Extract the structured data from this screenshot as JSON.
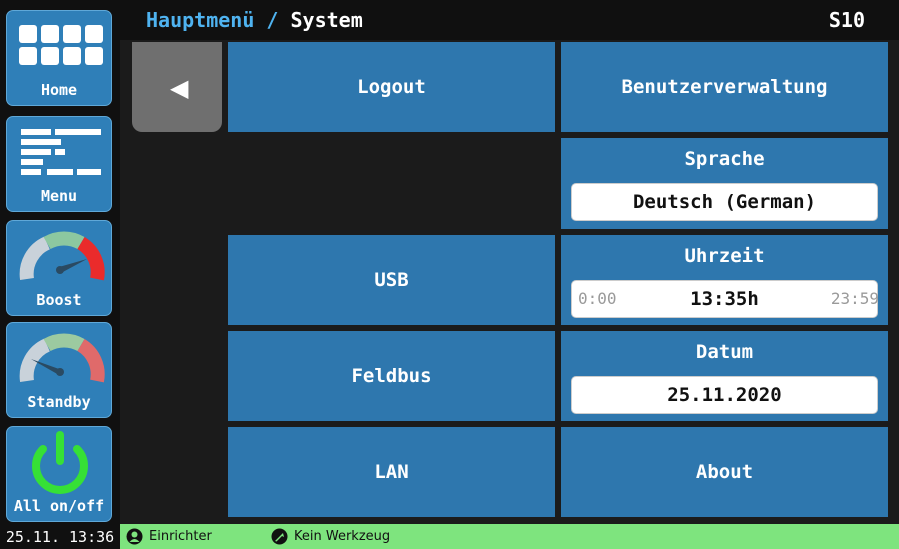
{
  "header": {
    "crumb_root": "Hauptmenü",
    "separator": "/",
    "crumb_current": "System",
    "code": "S10"
  },
  "sidebar": {
    "home_label": "Home",
    "menu_label": "Menu",
    "boost_label": "Boost",
    "standby_label": "Standby",
    "allonoff_label": "All on/off"
  },
  "main": {
    "back_glyph": "◀",
    "logout": "Logout",
    "benutzer": "Benutzerverwaltung",
    "sprache": {
      "title": "Sprache",
      "value": "Deutsch (German)"
    },
    "usb": "USB",
    "uhrzeit": {
      "title": "Uhrzeit",
      "min": "0:00",
      "value": "13:35h",
      "max": "23:59"
    },
    "feldbus": "Feldbus",
    "datum": {
      "title": "Datum",
      "value": "25.11.2020"
    },
    "lan": "LAN",
    "about": "About"
  },
  "footer": {
    "datetime": "25.11. 13:36",
    "user": "Einrichter",
    "tool": "Kein Werkzeug"
  },
  "colors": {
    "tile": "#2e77ae",
    "header_crumb": "#4fb3f0",
    "status_bar": "#7ee47e",
    "back": "#6f6f6f"
  },
  "icons": [
    "home-grid-icon",
    "menu-bars-icon",
    "boost-gauge-icon",
    "standby-gauge-icon",
    "power-icon",
    "user-icon",
    "tool-icon"
  ]
}
